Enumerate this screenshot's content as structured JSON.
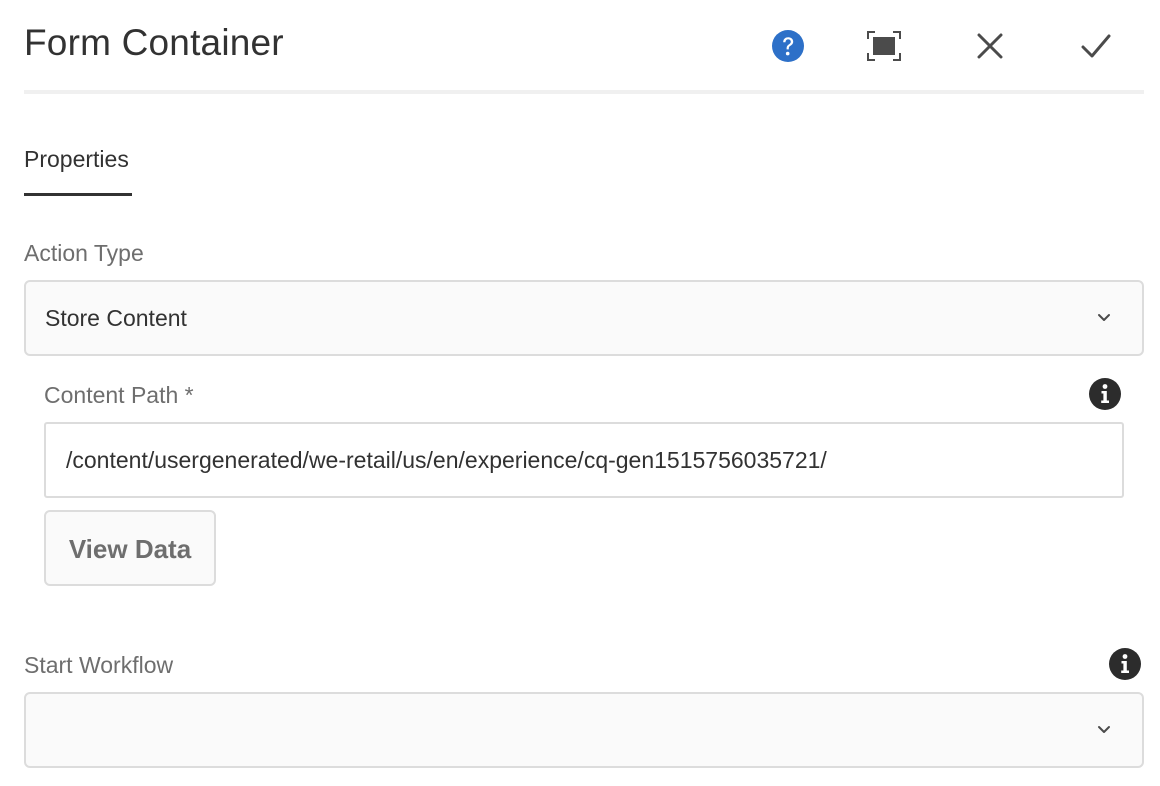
{
  "dialog": {
    "title": "Form Container",
    "help_icon": "help-icon",
    "fullscreen_icon": "fullscreen-icon",
    "close_icon": "close-icon",
    "done_icon": "checkmark-icon"
  },
  "tabs": [
    {
      "label": "Properties",
      "active": true
    }
  ],
  "fields": {
    "action_type": {
      "label": "Action Type",
      "value": "Store Content"
    },
    "content_path": {
      "label": "Content Path *",
      "value": "/content/usergenerated/we-retail/us/en/experience/cq-gen1515756035721/",
      "info_icon": "info-icon"
    },
    "view_data": {
      "label": "View Data"
    },
    "start_workflow": {
      "label": "Start Workflow",
      "value": "",
      "info_icon": "info-icon"
    }
  },
  "colors": {
    "accent_blue": "#2d70c8",
    "text": "#323232",
    "label": "#6e6e6e",
    "border": "#dcdcdc"
  }
}
